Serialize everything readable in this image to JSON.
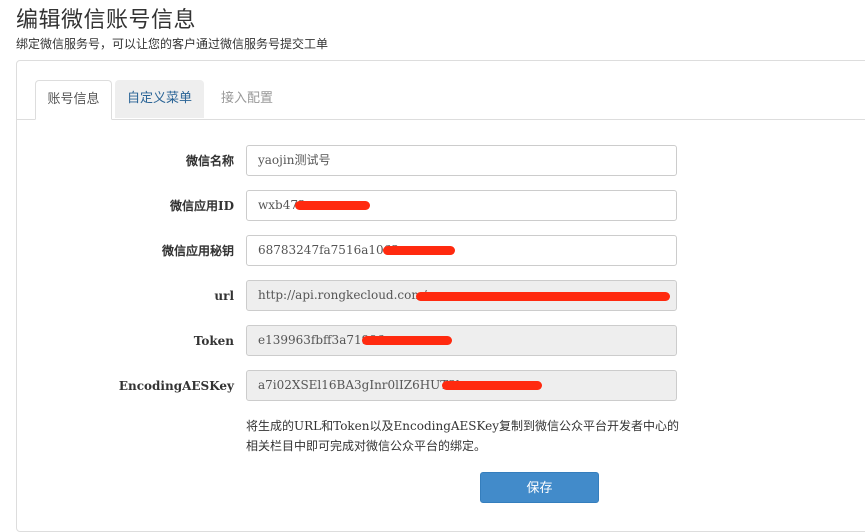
{
  "page": {
    "title": "编辑微信账号信息",
    "subtitle": "绑定微信服务号，可以让您的客户通过微信服务号提交工单"
  },
  "tabs": [
    {
      "label": "账号信息",
      "active": true
    },
    {
      "label": "自定义菜单",
      "active": false
    },
    {
      "label": "接入配置",
      "active": false
    }
  ],
  "form": {
    "wechat_name": {
      "label": "微信名称",
      "value": "yaojin测试号"
    },
    "app_id": {
      "label": "微信应用ID",
      "value": "wxb472"
    },
    "app_secret": {
      "label": "微信应用秘钥",
      "value": "68783247fa7516a1063ac"
    },
    "url": {
      "label": "url",
      "value": "http://api.rongkecloud.com/n"
    },
    "token": {
      "label": "Token",
      "value": "e139963fbff3a71986"
    },
    "aes_key": {
      "label": "EncodingAESKey",
      "value": "a7i02XSEl16BA3gInr0lIZ6HUT3h"
    }
  },
  "hint": "将生成的URL和Token以及EncodingAESKey复制到微信公众平台开发者中心的相关栏目中即可完成对微信公众平台的绑定。",
  "save_label": "保存",
  "colors": {
    "primary": "#428bca",
    "redaction": "#ff2a0f",
    "readonly_bg": "#eeeeee"
  }
}
